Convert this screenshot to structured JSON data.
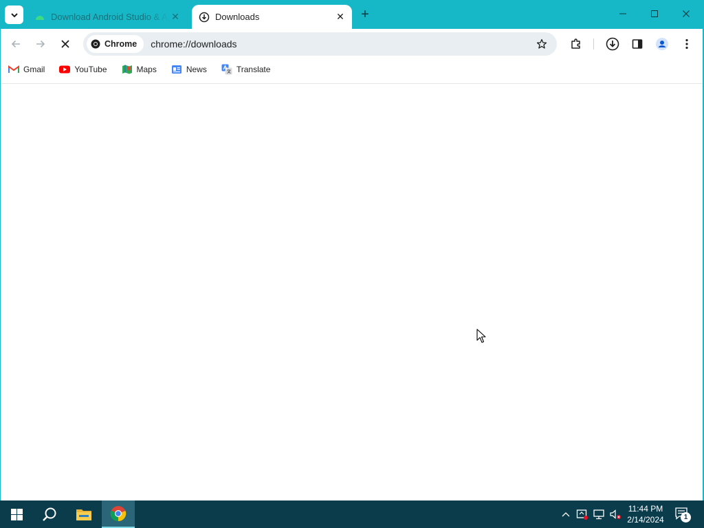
{
  "browser": {
    "tabs": [
      {
        "title": "Download Android Studio & App Tools",
        "favicon": "android-icon",
        "active": false
      },
      {
        "title": "Downloads",
        "favicon": "downloads-icon",
        "active": true
      }
    ],
    "new_tab_label": "+",
    "omnibox": {
      "chip_label": "Chrome",
      "url": "chrome://downloads"
    },
    "bookmarks": [
      {
        "label": "Gmail",
        "icon": "gmail-icon"
      },
      {
        "label": "YouTube",
        "icon": "youtube-icon"
      },
      {
        "label": "Maps",
        "icon": "maps-icon"
      },
      {
        "label": "News",
        "icon": "news-icon"
      },
      {
        "label": "Translate",
        "icon": "translate-icon"
      }
    ],
    "colors": {
      "frame": "#16b8c7",
      "omnibox_bg": "#e8eef1"
    }
  },
  "taskbar": {
    "clock_time": "11:44 PM",
    "clock_date": "2/14/2024",
    "notification_count": "1",
    "pinned": [
      "start-icon",
      "search-icon",
      "file-explorer-icon",
      "chrome-icon"
    ],
    "colors": {
      "bg": "#0b3c4c"
    }
  }
}
